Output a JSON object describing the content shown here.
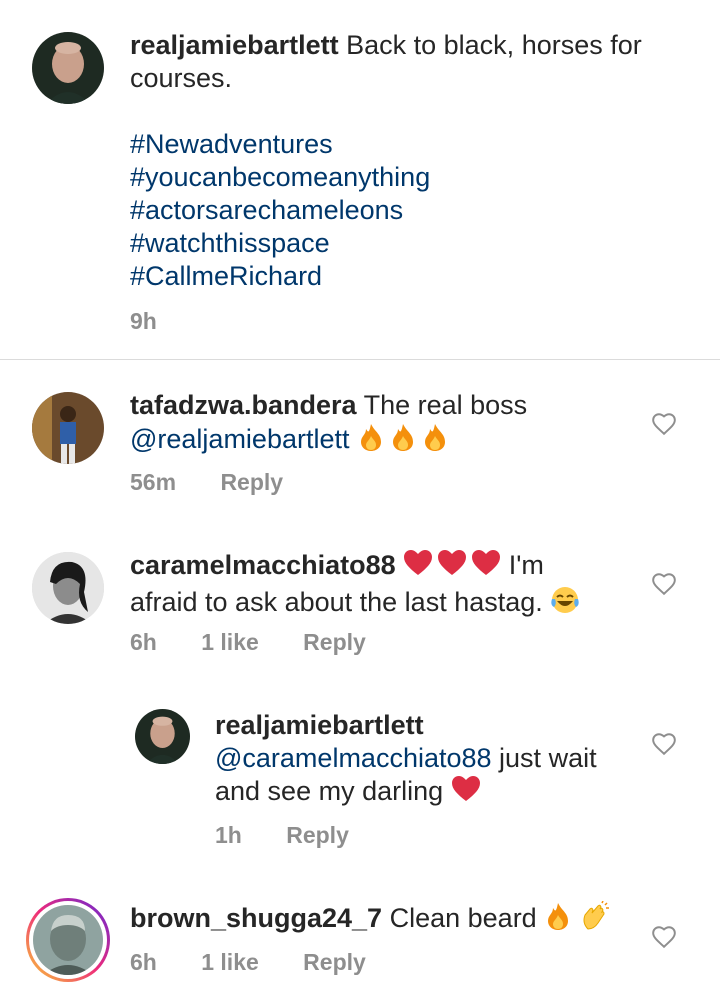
{
  "caption": {
    "username": "realjamiebartlett",
    "text": "Back to black, horses for courses.",
    "hashtags": [
      "#Newadventures",
      "#youcanbecomeanything",
      "#actorsarechameleons",
      "#watchthisspace",
      "#CallmeRichard"
    ],
    "time": "9h"
  },
  "comments": [
    {
      "username": "tafadzwa.bandera",
      "text": "The real boss",
      "mention": "@realjamiebartlett",
      "emoji": "fire-emoji x3",
      "time": "56m",
      "reply_label": "Reply"
    },
    {
      "username": "caramelmacchiato88",
      "emoji_after_name": "red-heart-emoji x3",
      "text_line1": "I'm",
      "text_line2": "afraid to ask about the last hastag.",
      "emoji_end": "tears-of-joy-emoji",
      "time": "6h",
      "likes": "1 like",
      "reply_label": "Reply"
    },
    {
      "username": "realjamiebartlett",
      "mention": "@caramelmacchiato88",
      "text_line1": "just wait",
      "text_line2": "and see my darling",
      "emoji_end": "red-heart-emoji",
      "time": "1h",
      "reply_label": "Reply"
    },
    {
      "username": "brown_shugga24_7",
      "text": "Clean beard",
      "emoji_end": "fire-emoji, clapping-hands-emoji",
      "time": "6h",
      "likes": "1 like",
      "reply_label": "Reply"
    }
  ],
  "colors": {
    "text": "#262626",
    "link": "#00376b",
    "meta": "#8e8e8e",
    "story_ring": [
      "#f9ce34",
      "#ee2a7b",
      "#6228d7"
    ],
    "heart_emoji": "#dd2e44"
  }
}
